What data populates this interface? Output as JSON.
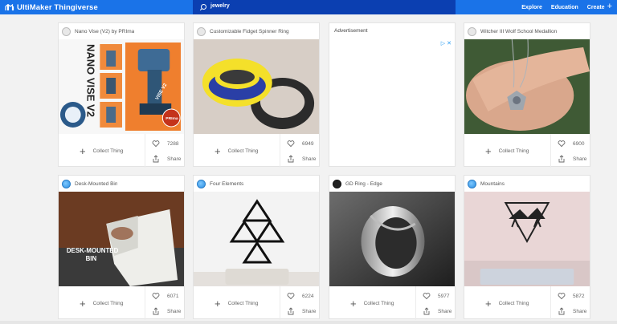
{
  "header": {
    "brand": "UltiMaker Thingiverse",
    "search_value": "jewelry",
    "nav": [
      "Explore",
      "Education",
      "Create"
    ]
  },
  "colors": {
    "topbar": "#1a73e8",
    "search_bg": "#0b3fb1"
  },
  "cards": [
    {
      "title": "Nano Vise (V2) by PRIma",
      "likes": "7288",
      "collect_label": "Collect Thing",
      "share_label": "Share",
      "avatar": "light"
    },
    {
      "title": "Customizable Fidget Spinner Ring",
      "likes": "6949",
      "collect_label": "Collect Thing",
      "share_label": "Share",
      "avatar": "light"
    },
    {
      "title": "Witcher III Wolf School Medallion",
      "likes": "6900",
      "collect_label": "Collect Thing",
      "share_label": "Share",
      "avatar": "light"
    },
    {
      "title": "Desk-Mounted Bin",
      "likes": "6071",
      "collect_label": "Collect Thing",
      "share_label": "Share",
      "avatar": "globe"
    },
    {
      "title": "Four Elements",
      "likes": "6224",
      "collect_label": "Collect Thing",
      "share_label": "Share",
      "avatar": "globe"
    },
    {
      "title": "GD Ring - Edge",
      "likes": "5977",
      "collect_label": "Collect Thing",
      "share_label": "Share",
      "avatar": "dark"
    },
    {
      "title": "Mountains",
      "likes": "5872",
      "collect_label": "Collect Thing",
      "share_label": "Share",
      "avatar": "globe"
    }
  ],
  "thumb_text": {
    "nano_vise_title": "NANO VISE V2",
    "nano_vise_badge": "PRIma",
    "desk_bin_caption": [
      "DESK-MOUNTED",
      "BIN"
    ]
  },
  "advertisement": {
    "label": "Advertisement",
    "adchoices": "▷ ✕"
  }
}
